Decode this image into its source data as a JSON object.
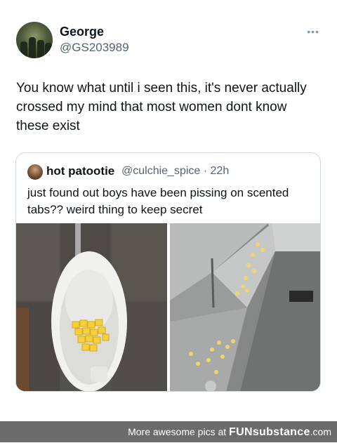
{
  "tweet": {
    "author_name": "George",
    "author_handle": "@GS203989",
    "more_icon": "•••",
    "text": "You know what until i seen this, it's never actually crossed my mind that most women dont know these exist"
  },
  "quote": {
    "author_name": "hot patootie",
    "author_handle": "@culchie_spice · 22h",
    "text": "just found out boys have been pissing on scented tabs?? weird thing to keep secret"
  },
  "footer": {
    "prefix": "More awesome pics at ",
    "brand": "FUNsubstance",
    "suffix": ".com"
  }
}
